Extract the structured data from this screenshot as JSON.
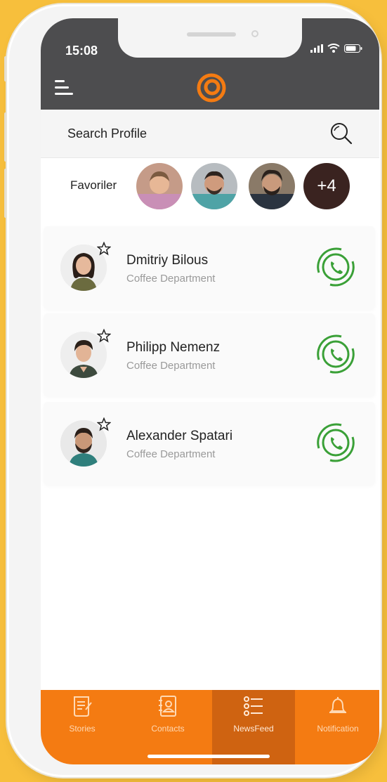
{
  "status_bar": {
    "time": "15:08"
  },
  "search": {
    "placeholder": "Search Profile"
  },
  "favorites": {
    "label": "Favoriler",
    "more": "+4"
  },
  "contacts": [
    {
      "name": "Dmitriy Bilous",
      "department": "Coffee Department"
    },
    {
      "name": "Philipp Nemenz",
      "department": "Coffee Department"
    },
    {
      "name": "Alexander Spatari",
      "department": "Coffee Department"
    }
  ],
  "tabs": [
    {
      "label": "Stories",
      "icon": "stories-icon"
    },
    {
      "label": "Contacts",
      "icon": "contacts-icon"
    },
    {
      "label": "NewsFeed",
      "icon": "newsfeed-icon",
      "active": true
    },
    {
      "label": "Notification",
      "icon": "bell-icon"
    }
  ],
  "colors": {
    "accent": "#f47b12",
    "accent_dark": "#cf6311",
    "header": "#4d4d4f",
    "call_green": "#3aa037",
    "background": "#f7bf3c"
  }
}
